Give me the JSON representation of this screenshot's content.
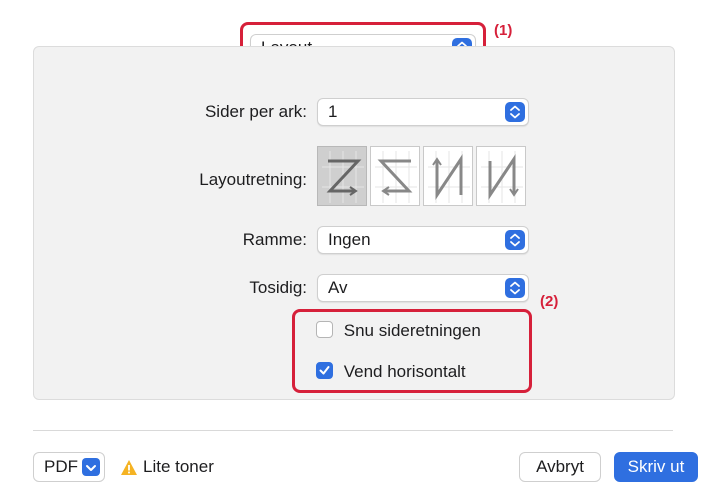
{
  "top_popup": {
    "value": "Layout"
  },
  "annotations": {
    "first": "(1)",
    "second": "(2)"
  },
  "fields": {
    "pages_per_sheet": {
      "label": "Sider per ark:",
      "value": "1"
    },
    "layout_direction": {
      "label": "Layoutretning:"
    },
    "border": {
      "label": "Ramme:",
      "value": "Ingen"
    },
    "two_sided": {
      "label": "Tosidig:",
      "value": "Av"
    }
  },
  "checkboxes": {
    "flip_orientation": {
      "label": "Snu sideretningen",
      "checked": false
    },
    "flip_horizontal": {
      "label": "Vend horisontalt",
      "checked": true
    }
  },
  "footer": {
    "pdf_label": "PDF",
    "warning_text": "Lite toner",
    "cancel_label": "Avbryt",
    "print_label": "Skriv ut"
  },
  "colors": {
    "accent": "#2f6fe0",
    "annotation": "#d6203a",
    "warning": "#f5b323"
  }
}
